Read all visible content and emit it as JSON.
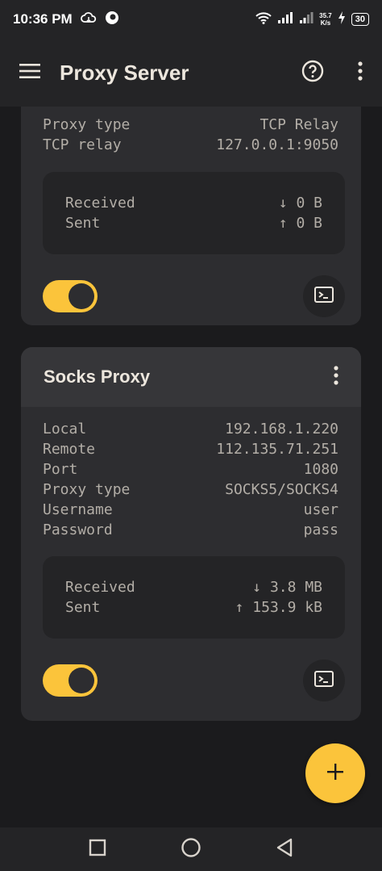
{
  "status_bar": {
    "time": "10:36 PM",
    "speed_value": "35.7",
    "speed_unit": "K/s",
    "battery": "30"
  },
  "app_bar": {
    "title": "Proxy Server"
  },
  "cards": [
    {
      "rows": [
        {
          "key": "Proxy type",
          "value": "TCP Relay"
        },
        {
          "key": "TCP relay",
          "value": "127.0.0.1:9050"
        }
      ],
      "received_label": "Received",
      "received_value": "↓ 0 B",
      "sent_label": "Sent",
      "sent_value": "↑ 0 B",
      "enabled": true
    },
    {
      "title": "Socks Proxy",
      "rows": [
        {
          "key": "Local",
          "value": "192.168.1.220"
        },
        {
          "key": "Remote",
          "value": "112.135.71.251"
        },
        {
          "key": "Port",
          "value": "1080"
        },
        {
          "key": "Proxy type",
          "value": "SOCKS5/SOCKS4"
        },
        {
          "key": "Username",
          "value": "user"
        },
        {
          "key": "Password",
          "value": "pass"
        }
      ],
      "received_label": "Received",
      "received_value": "↓ 3.8 MB",
      "sent_label": "Sent",
      "sent_value": "↑ 153.9 kB",
      "enabled": true
    }
  ],
  "colors": {
    "accent": "#fbc43b",
    "background": "#1b1b1d",
    "card": "#2d2d30",
    "card_header": "#363639",
    "bar": "#242426"
  },
  "icons": [
    "menu-icon",
    "help-icon",
    "more-vert-icon",
    "terminal-icon",
    "add-icon",
    "recents-icon",
    "home-icon",
    "back-icon"
  ]
}
